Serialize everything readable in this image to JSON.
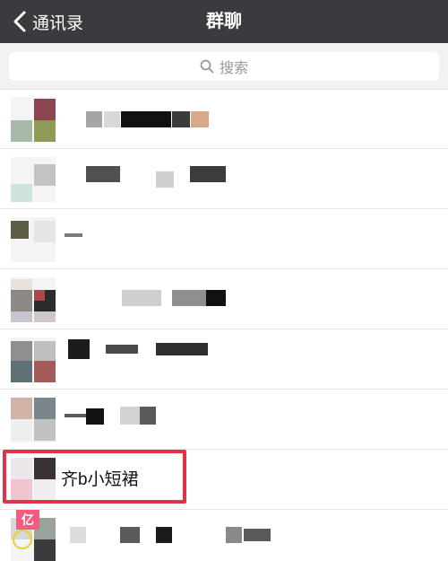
{
  "nav": {
    "back_label": "通讯录",
    "title": "群聊"
  },
  "search": {
    "placeholder": "搜索"
  },
  "highlight_color": "#e0334a",
  "groups": [
    {
      "name": ""
    },
    {
      "name": ""
    },
    {
      "name": ""
    },
    {
      "name": ""
    },
    {
      "name": ""
    },
    {
      "name": ""
    },
    {
      "name": "齐b小短裙"
    },
    {
      "name": ""
    }
  ],
  "overlay_tag": "亿",
  "icons": [
    "chevron-left-icon",
    "search-icon"
  ]
}
